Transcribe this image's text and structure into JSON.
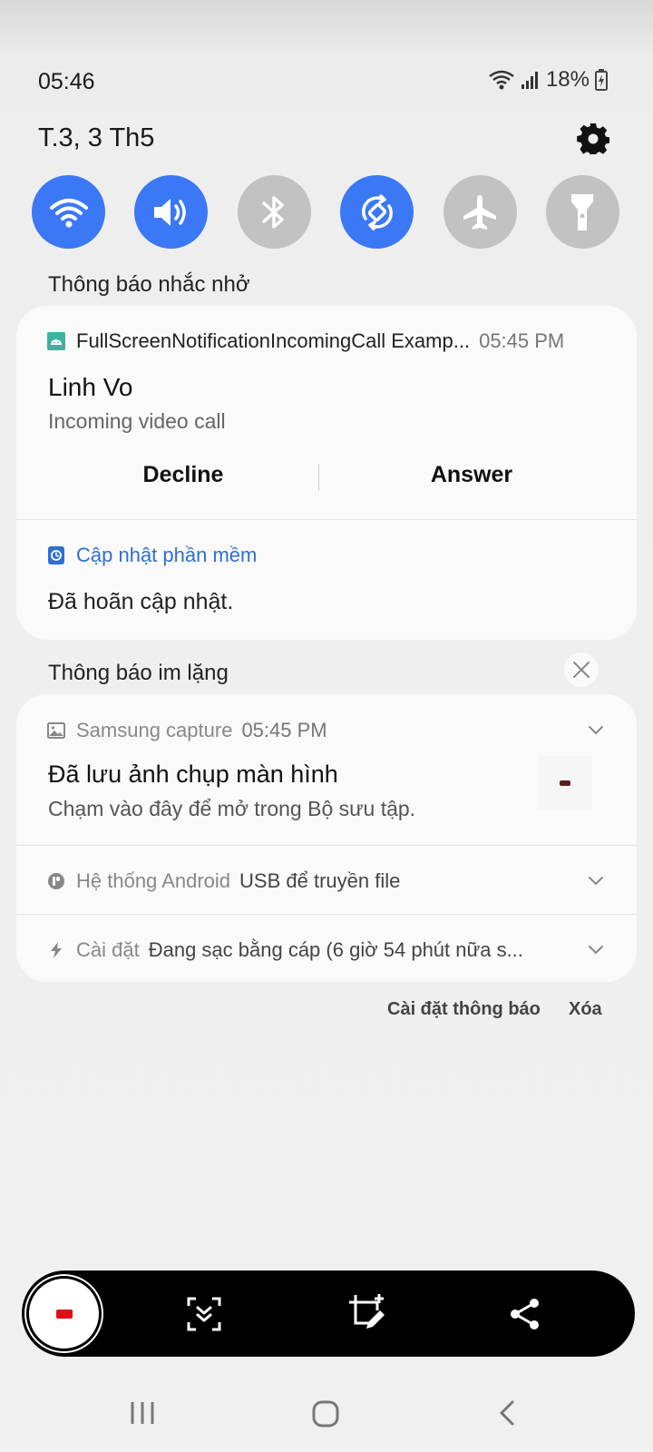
{
  "status": {
    "time": "05:46",
    "battery_text": "18%"
  },
  "header": {
    "date": "T.3, 3 Th5"
  },
  "quick_settings": [
    {
      "name": "wifi",
      "state": "on"
    },
    {
      "name": "sound",
      "state": "on"
    },
    {
      "name": "bluetooth",
      "state": "off"
    },
    {
      "name": "auto-rotate",
      "state": "on"
    },
    {
      "name": "airplane-mode",
      "state": "off"
    },
    {
      "name": "flashlight",
      "state": "off"
    }
  ],
  "sections": {
    "alerting_label": "Thông báo nhắc nhở",
    "silent_label": "Thông báo im lặng"
  },
  "call_notification": {
    "app_name": "FullScreenNotificationIncomingCall Examp...",
    "time": "05:45 PM",
    "title": "Linh Vo",
    "text": "Incoming video call",
    "decline_label": "Decline",
    "answer_label": "Answer"
  },
  "update_notification": {
    "app_name": "Cập nhật phần mềm",
    "text": "Đã hoãn cập nhật."
  },
  "capture_notification": {
    "app_name": "Samsung capture",
    "time": "05:45 PM",
    "title": "Đã lưu ảnh chụp màn hình",
    "text": "Chạm vào đây để mở trong Bộ sưu tập."
  },
  "android_notification": {
    "app_name": "Hệ thống Android",
    "text": "USB để truyền file"
  },
  "charging_notification": {
    "app_name": "Cài đặt",
    "text": "Đang sạc bằng cáp (6 giờ 54 phút nữa s..."
  },
  "footer": {
    "settings_label": "Cài đặt thông báo",
    "clear_label": "Xóa"
  },
  "colors": {
    "accent": "#3a78f5",
    "tile_off": "#c2c2c2",
    "link_blue": "#2f6fd0"
  }
}
